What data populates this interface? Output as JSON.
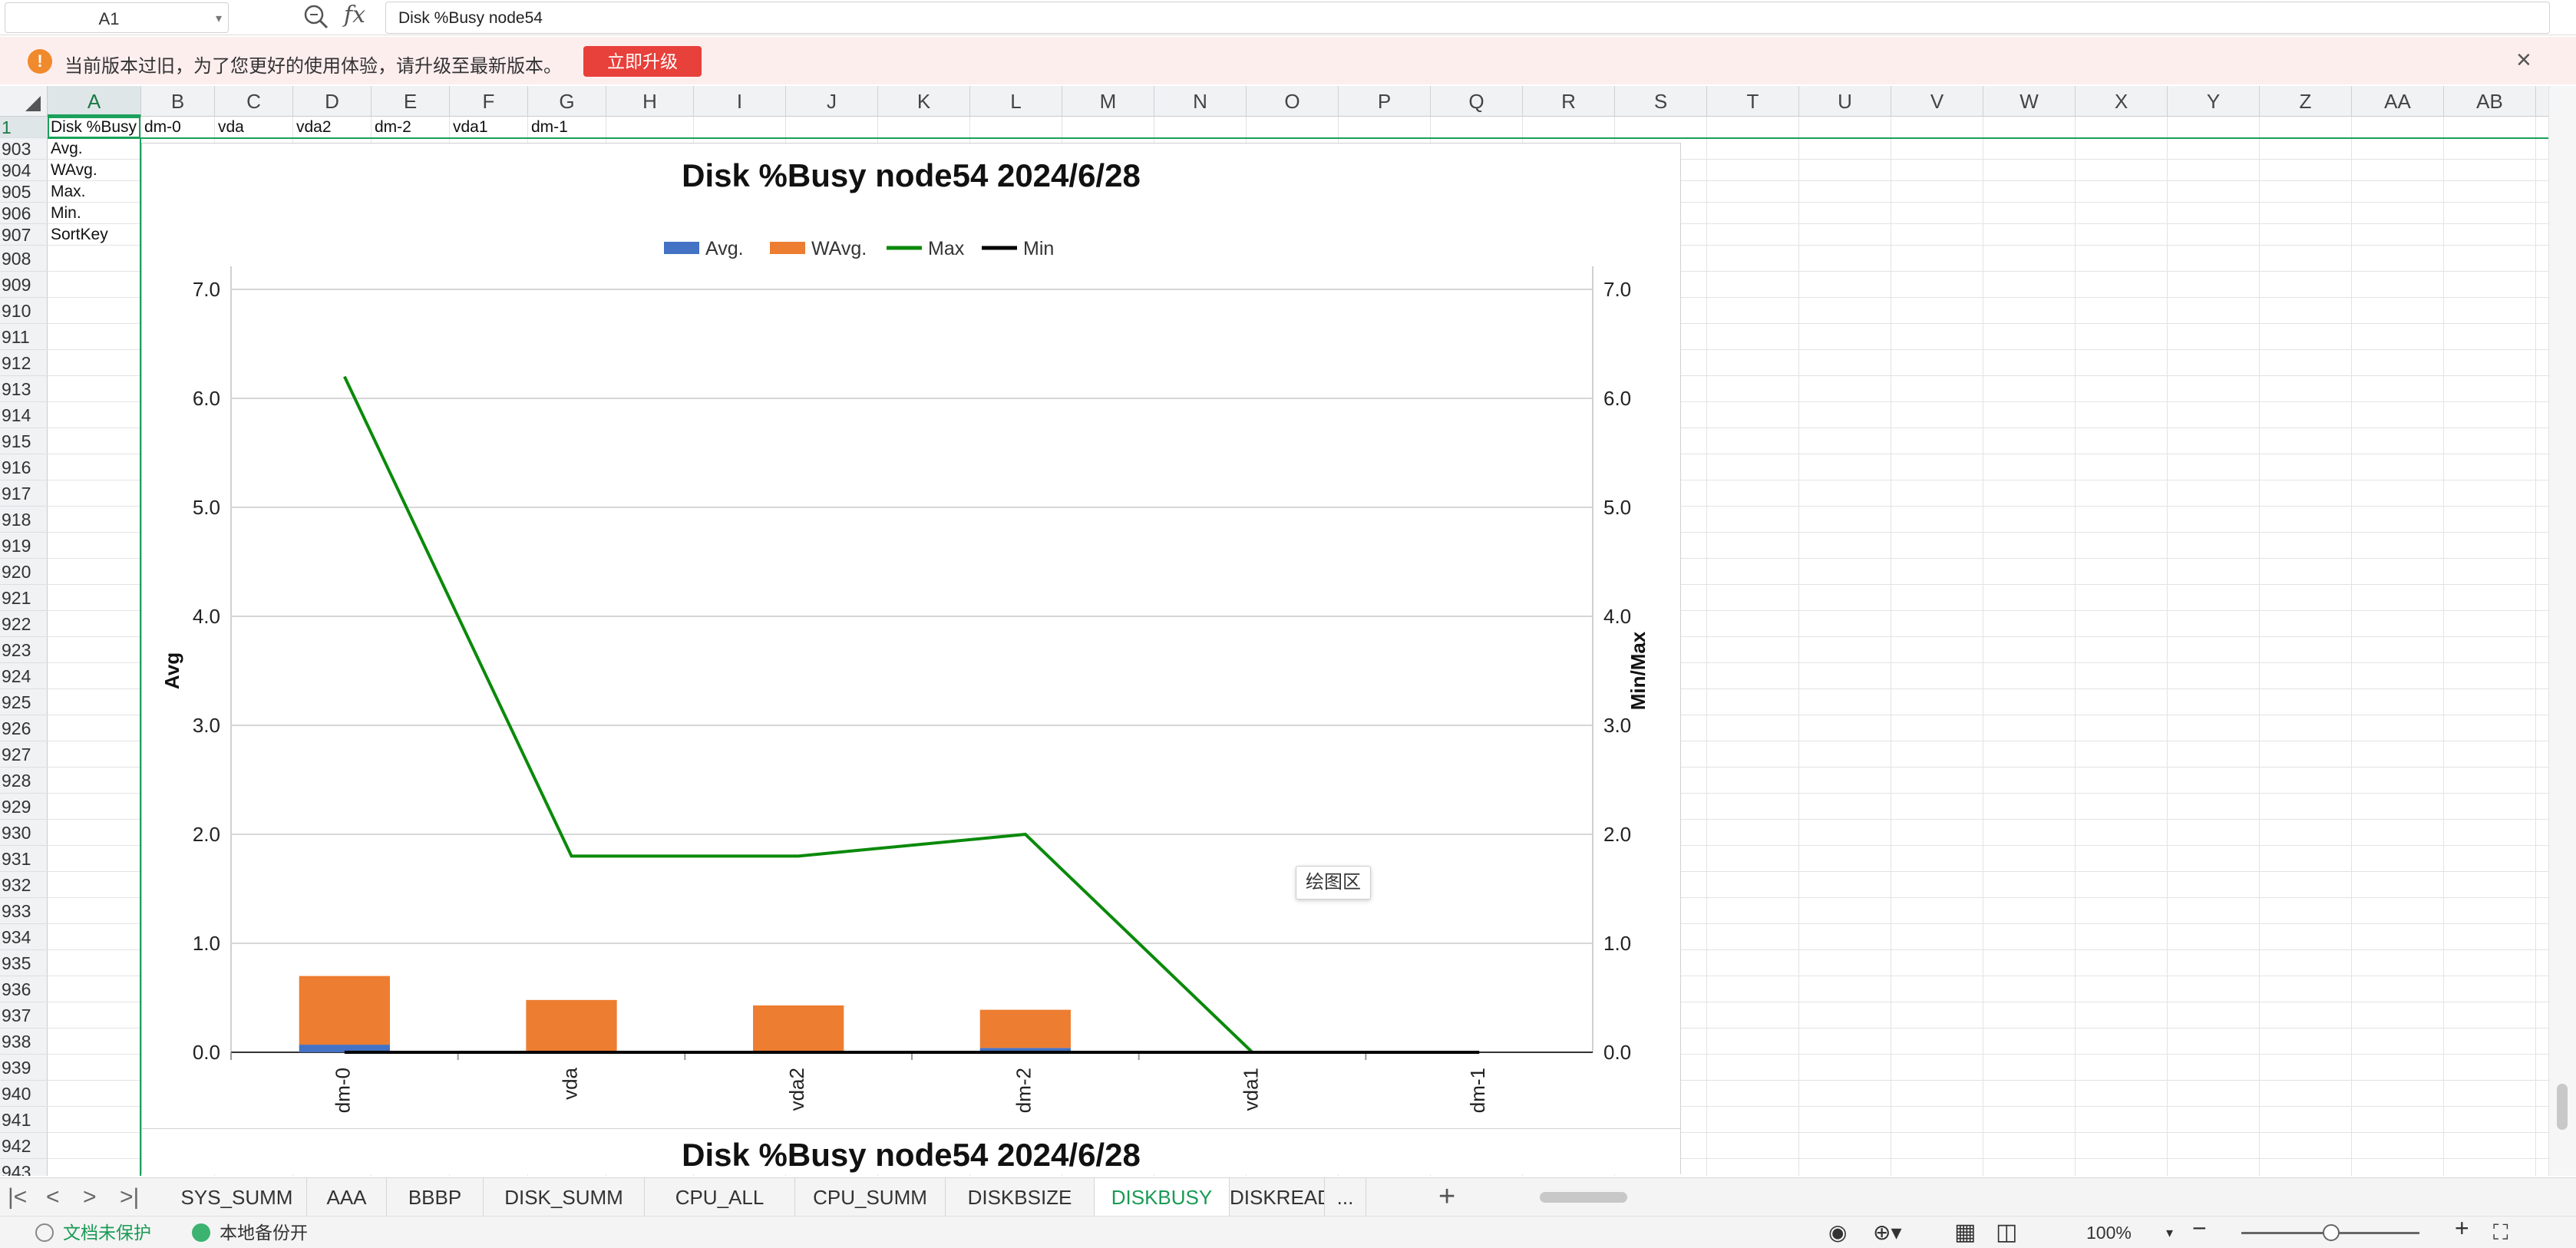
{
  "formula_bar": {
    "name_box": "A1",
    "fx": "fx",
    "formula": "Disk %Busy node54"
  },
  "notice": {
    "text": "当前版本过旧，为了您更好的使用体验，请升级至最新版本。",
    "button": "立即升级",
    "close": "×"
  },
  "columns": [
    "A",
    "B",
    "C",
    "D",
    "E",
    "F",
    "G",
    "H",
    "I",
    "J",
    "K",
    "L",
    "M",
    "N",
    "O",
    "P",
    "Q",
    "R",
    "S",
    "T",
    "U",
    "V",
    "W",
    "X",
    "Y",
    "Z",
    "AA",
    "AB"
  ],
  "rows": [
    "1",
    "903",
    "904",
    "905",
    "906",
    "907",
    "908",
    "909",
    "910",
    "911",
    "912",
    "913",
    "914",
    "915",
    "916",
    "917",
    "918",
    "919",
    "920",
    "921",
    "922",
    "923",
    "924",
    "925",
    "926",
    "927",
    "928",
    "929",
    "930",
    "931",
    "932",
    "933",
    "934",
    "935",
    "936",
    "937",
    "938",
    "939",
    "940",
    "941",
    "942",
    "943"
  ],
  "cells": {
    "row1": [
      "Disk  %Busy",
      "dm-0",
      "vda",
      "vda2",
      "dm-2",
      "vda1",
      "dm-1"
    ],
    "colA": [
      "Avg.",
      "WAvg.",
      "Max.",
      "Min.",
      "SortKey"
    ]
  },
  "chart_data": {
    "type": "bar",
    "title": "Disk %Busy node54  2024/6/28",
    "categories": [
      "dm-0",
      "vda",
      "vda2",
      "dm-2",
      "vda1",
      "dm-1"
    ],
    "series": [
      {
        "name": "Avg.",
        "kind": "bar",
        "color": "#4472c4",
        "values": [
          0.07,
          0.0,
          0.0,
          0.04,
          0.0,
          0.0
        ]
      },
      {
        "name": "WAvg.",
        "kind": "bar",
        "color": "#ed7d31",
        "values": [
          0.63,
          0.48,
          0.43,
          0.35,
          0.0,
          0.0
        ]
      },
      {
        "name": "Max",
        "kind": "line",
        "axis": "right",
        "color": "#0a8a0a",
        "values": [
          6.2,
          1.8,
          1.8,
          2.0,
          0.0,
          0.0
        ]
      },
      {
        "name": "Min",
        "kind": "line",
        "axis": "right",
        "color": "#000000",
        "values": [
          0.0,
          0.0,
          0.0,
          0.0,
          0.0,
          0.0
        ]
      }
    ],
    "ylabel": "Avg",
    "y2label": "Min/Max",
    "ylim": [
      0,
      7
    ],
    "y2lim": [
      0,
      7
    ],
    "yticks": [
      "0.0",
      "1.0",
      "2.0",
      "3.0",
      "4.0",
      "5.0",
      "6.0",
      "7.0"
    ],
    "grid": true,
    "legend": "top"
  },
  "chart_tooltip": "绘图区",
  "sheet_tabs": [
    "SYS_SUMM",
    "AAA",
    "BBBP",
    "DISK_SUMM",
    "CPU_ALL",
    "CPU_SUMM",
    "DISKBSIZE",
    "DISKBUSY",
    "DISKREAD",
    "..."
  ],
  "active_tab": "DISKBUSY",
  "status": {
    "protection": "文档未保护",
    "backup": "本地备份开",
    "zoom": "100%"
  }
}
